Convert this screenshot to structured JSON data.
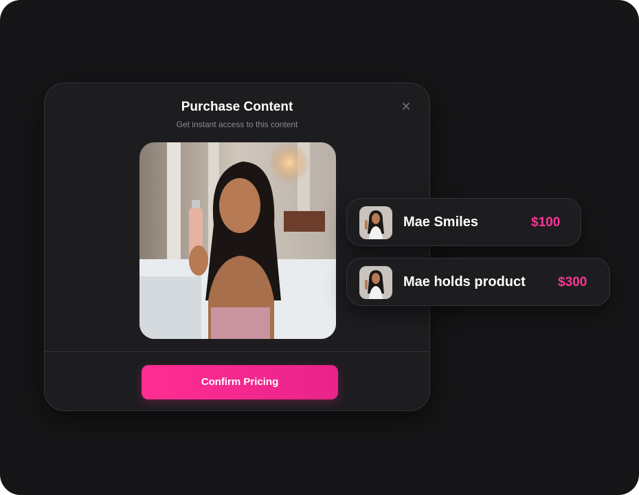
{
  "modal": {
    "title": "Purchase Content",
    "subtitle": "Get instant access to this content",
    "close_icon": "close-icon",
    "confirm_label": "Confirm Pricing"
  },
  "items": [
    {
      "name": "Mae Smiles",
      "price": "$100"
    },
    {
      "name": "Mae holds product",
      "price": "$300"
    }
  ],
  "colors": {
    "accent": "#ff2d92",
    "background": "#161618",
    "card": "#1d1d20"
  }
}
